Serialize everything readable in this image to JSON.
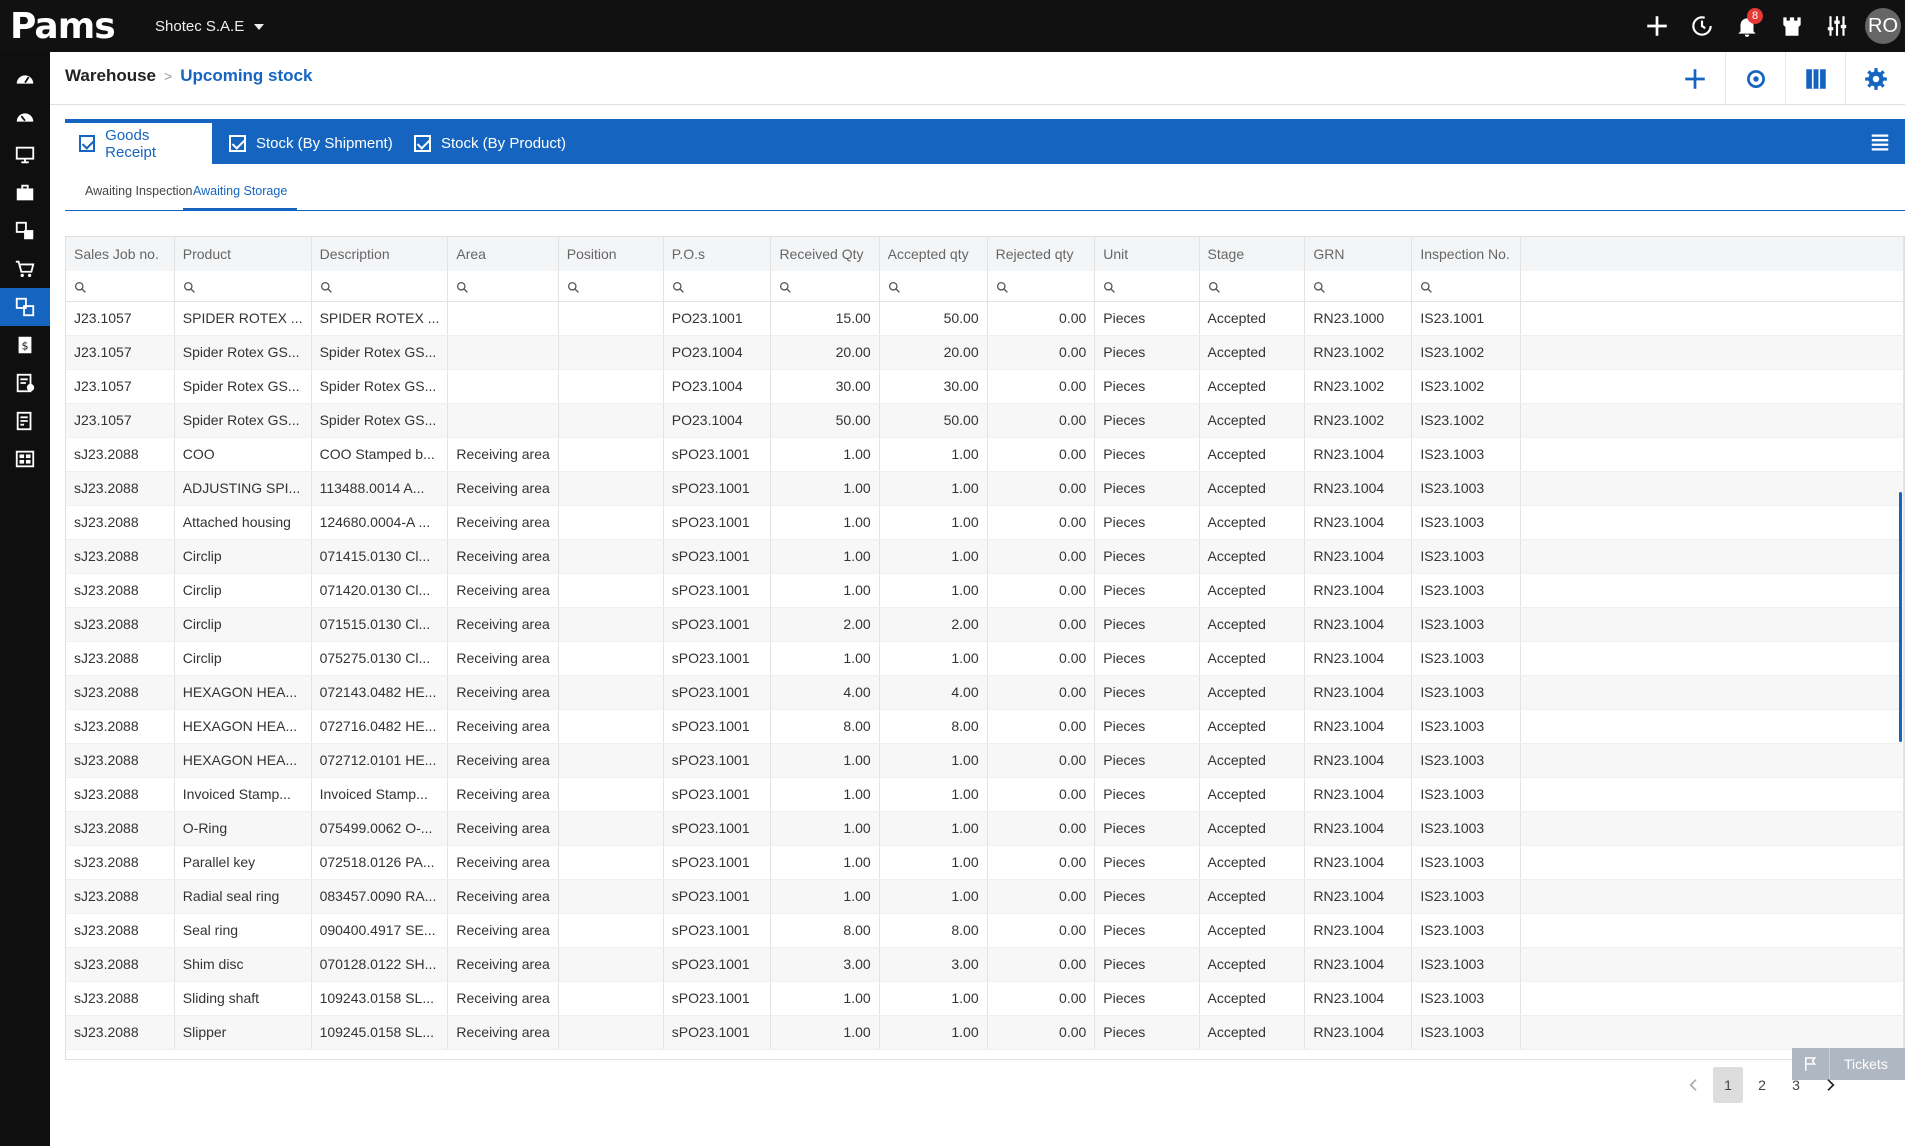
{
  "app": {
    "logo": "Pams",
    "company": "Shotec S.A.E",
    "notification_count": "8",
    "user_initials": "RO"
  },
  "breadcrumb": {
    "root": "Warehouse",
    "current": "Upcoming stock"
  },
  "tabs": [
    {
      "label": "Goods Receipt",
      "active": true
    },
    {
      "label": "Stock (By Shipment)",
      "active": false
    },
    {
      "label": "Stock (By Product)",
      "active": false
    }
  ],
  "subtabs": [
    {
      "label": "Awaiting Inspection",
      "active": false
    },
    {
      "label": "Awaiting Storage",
      "active": true
    }
  ],
  "table": {
    "columns": [
      "Sales Job no.",
      "Product",
      "Description",
      "Area",
      "Position",
      "P.O.s",
      "Received Qty",
      "Accepted qty",
      "Rejected qty",
      "Unit",
      "Stage",
      "GRN",
      "Inspection No."
    ],
    "rows": [
      [
        "J23.1057",
        "SPIDER ROTEX ...",
        "SPIDER ROTEX ...",
        "",
        "",
        "PO23.1001",
        "15.00",
        "50.00",
        "0.00",
        "Pieces",
        "Accepted",
        "RN23.1000",
        "IS23.1001"
      ],
      [
        "J23.1057",
        "Spider Rotex GS...",
        "Spider Rotex GS...",
        "",
        "",
        "PO23.1004",
        "20.00",
        "20.00",
        "0.00",
        "Pieces",
        "Accepted",
        "RN23.1002",
        "IS23.1002"
      ],
      [
        "J23.1057",
        "Spider Rotex GS...",
        "Spider Rotex GS...",
        "",
        "",
        "PO23.1004",
        "30.00",
        "30.00",
        "0.00",
        "Pieces",
        "Accepted",
        "RN23.1002",
        "IS23.1002"
      ],
      [
        "J23.1057",
        "Spider Rotex GS...",
        "Spider Rotex GS...",
        "",
        "",
        "PO23.1004",
        "50.00",
        "50.00",
        "0.00",
        "Pieces",
        "Accepted",
        "RN23.1002",
        "IS23.1002"
      ],
      [
        "sJ23.2088",
        "COO",
        "COO Stamped b...",
        "Receiving area",
        "",
        "sPO23.1001",
        "1.00",
        "1.00",
        "0.00",
        "Pieces",
        "Accepted",
        "RN23.1004",
        "IS23.1003"
      ],
      [
        "sJ23.2088",
        "ADJUSTING SPI...",
        "113488.0014 A...",
        "Receiving area",
        "",
        "sPO23.1001",
        "1.00",
        "1.00",
        "0.00",
        "Pieces",
        "Accepted",
        "RN23.1004",
        "IS23.1003"
      ],
      [
        "sJ23.2088",
        "Attached housing",
        "124680.0004-A ...",
        "Receiving area",
        "",
        "sPO23.1001",
        "1.00",
        "1.00",
        "0.00",
        "Pieces",
        "Accepted",
        "RN23.1004",
        "IS23.1003"
      ],
      [
        "sJ23.2088",
        "Circlip",
        "071415.0130 Cl...",
        "Receiving area",
        "",
        "sPO23.1001",
        "1.00",
        "1.00",
        "0.00",
        "Pieces",
        "Accepted",
        "RN23.1004",
        "IS23.1003"
      ],
      [
        "sJ23.2088",
        "Circlip",
        "071420.0130 Cl...",
        "Receiving area",
        "",
        "sPO23.1001",
        "1.00",
        "1.00",
        "0.00",
        "Pieces",
        "Accepted",
        "RN23.1004",
        "IS23.1003"
      ],
      [
        "sJ23.2088",
        "Circlip",
        "071515.0130 Cl...",
        "Receiving area",
        "",
        "sPO23.1001",
        "2.00",
        "2.00",
        "0.00",
        "Pieces",
        "Accepted",
        "RN23.1004",
        "IS23.1003"
      ],
      [
        "sJ23.2088",
        "Circlip",
        "075275.0130 Cl...",
        "Receiving area",
        "",
        "sPO23.1001",
        "1.00",
        "1.00",
        "0.00",
        "Pieces",
        "Accepted",
        "RN23.1004",
        "IS23.1003"
      ],
      [
        "sJ23.2088",
        "HEXAGON HEA...",
        "072143.0482 HE...",
        "Receiving area",
        "",
        "sPO23.1001",
        "4.00",
        "4.00",
        "0.00",
        "Pieces",
        "Accepted",
        "RN23.1004",
        "IS23.1003"
      ],
      [
        "sJ23.2088",
        "HEXAGON HEA...",
        "072716.0482 HE...",
        "Receiving area",
        "",
        "sPO23.1001",
        "8.00",
        "8.00",
        "0.00",
        "Pieces",
        "Accepted",
        "RN23.1004",
        "IS23.1003"
      ],
      [
        "sJ23.2088",
        "HEXAGON HEA...",
        "072712.0101 HE...",
        "Receiving area",
        "",
        "sPO23.1001",
        "1.00",
        "1.00",
        "0.00",
        "Pieces",
        "Accepted",
        "RN23.1004",
        "IS23.1003"
      ],
      [
        "sJ23.2088",
        "Invoiced Stamp...",
        "Invoiced Stamp...",
        "Receiving area",
        "",
        "sPO23.1001",
        "1.00",
        "1.00",
        "0.00",
        "Pieces",
        "Accepted",
        "RN23.1004",
        "IS23.1003"
      ],
      [
        "sJ23.2088",
        "O-Ring",
        "075499.0062 O-...",
        "Receiving area",
        "",
        "sPO23.1001",
        "1.00",
        "1.00",
        "0.00",
        "Pieces",
        "Accepted",
        "RN23.1004",
        "IS23.1003"
      ],
      [
        "sJ23.2088",
        "Parallel key",
        "072518.0126 PA...",
        "Receiving area",
        "",
        "sPO23.1001",
        "1.00",
        "1.00",
        "0.00",
        "Pieces",
        "Accepted",
        "RN23.1004",
        "IS23.1003"
      ],
      [
        "sJ23.2088",
        "Radial seal ring",
        "083457.0090 RA...",
        "Receiving area",
        "",
        "sPO23.1001",
        "1.00",
        "1.00",
        "0.00",
        "Pieces",
        "Accepted",
        "RN23.1004",
        "IS23.1003"
      ],
      [
        "sJ23.2088",
        "Seal ring",
        "090400.4917 SE...",
        "Receiving area",
        "",
        "sPO23.1001",
        "8.00",
        "8.00",
        "0.00",
        "Pieces",
        "Accepted",
        "RN23.1004",
        "IS23.1003"
      ],
      [
        "sJ23.2088",
        "Shim disc",
        "070128.0122 SH...",
        "Receiving area",
        "",
        "sPO23.1001",
        "3.00",
        "3.00",
        "0.00",
        "Pieces",
        "Accepted",
        "RN23.1004",
        "IS23.1003"
      ],
      [
        "sJ23.2088",
        "Sliding shaft",
        "109243.0158 SL...",
        "Receiving area",
        "",
        "sPO23.1001",
        "1.00",
        "1.00",
        "0.00",
        "Pieces",
        "Accepted",
        "RN23.1004",
        "IS23.1003"
      ],
      [
        "sJ23.2088",
        "Slipper",
        "109245.0158 SL...",
        "Receiving area",
        "",
        "sPO23.1001",
        "1.00",
        "1.00",
        "0.00",
        "Pieces",
        "Accepted",
        "RN23.1004",
        "IS23.1003"
      ]
    ]
  },
  "pagination": {
    "pages": [
      "1",
      "2",
      "3"
    ],
    "current": "1"
  },
  "tickets_label": "Tickets",
  "colors": {
    "accent": "#1565c0",
    "topbar": "#111111",
    "sidebar": "#0f0f0f"
  }
}
